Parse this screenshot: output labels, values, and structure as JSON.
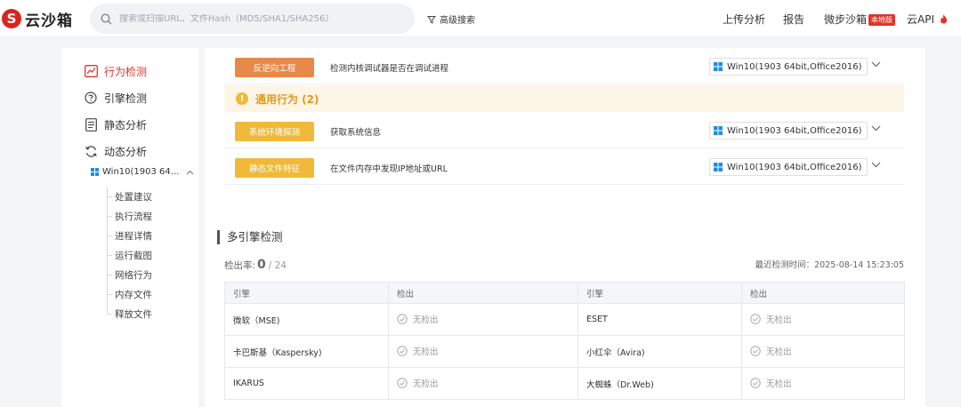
{
  "header": {
    "logo_mark": "S",
    "logo_text": "云沙箱",
    "search_placeholder": "搜索或扫描URL、文件Hash（MD5/SHA1/SHA256）",
    "advanced_search": "高级搜索",
    "nav": {
      "upload": "上传分析",
      "report": "报告",
      "wb_sandbox": "微步沙箱",
      "wb_badge": "本地版",
      "cloud_api": "云API"
    }
  },
  "sidebar": {
    "items": [
      {
        "label": "行为检测",
        "icon": "behavior-chart-icon"
      },
      {
        "label": "引擎检测",
        "icon": "question-circle-icon"
      },
      {
        "label": "静态分析",
        "icon": "document-icon"
      },
      {
        "label": "动态分析",
        "icon": "refresh-cycle-icon"
      }
    ],
    "env": "Win10(1903 64...",
    "sub_items": [
      "处置建议",
      "执行流程",
      "进程详情",
      "运行截图",
      "网络行为",
      "内存文件",
      "释放文件"
    ]
  },
  "behaviors": {
    "top_row": {
      "tag": "反逆向工程",
      "desc": "检测内核调试器是否在调试进程",
      "env": "Win10(1903 64bit,Office2016)"
    },
    "group_title": "通用行为 (2)",
    "group_rows": [
      {
        "tag": "系统环境探测",
        "desc": "获取系统信息",
        "env": "Win10(1903 64bit,Office2016)"
      },
      {
        "tag": "静态文件特征",
        "desc": "在文件内存中发现IP地址或URL",
        "env": "Win10(1903 64bit,Office2016)"
      }
    ]
  },
  "multi_engine": {
    "title": "多引擎检测",
    "rate_label": "检出率:",
    "rate_value": "0",
    "rate_total": "/ 24",
    "last_scan": "最近检测时间：2025-08-14 15:23:05",
    "columns": [
      "引擎",
      "检出",
      "引擎",
      "检出"
    ],
    "rows": [
      {
        "engine1": "微软（MSE)",
        "result1": "无检出",
        "engine2": "ESET",
        "result2": "无检出"
      },
      {
        "engine1": "卡巴斯基（Kaspersky)",
        "result1": "无检出",
        "engine2": "小红伞（Avira)",
        "result2": "无检出"
      },
      {
        "engine1": "IKARUS",
        "result1": "无检出",
        "engine2": "大蜘蛛（Dr.Web)",
        "result2": "无检出"
      }
    ]
  },
  "colors": {
    "accent": "#e0352b",
    "tag_orange": "#e8894a",
    "tag_yellow": "#f0b93a",
    "group_bg": "#fdf6e6"
  }
}
